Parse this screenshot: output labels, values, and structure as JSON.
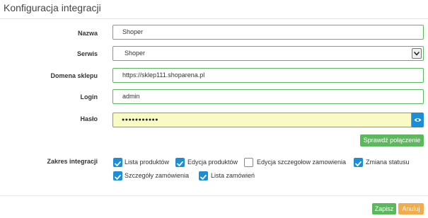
{
  "header": {
    "title": "Konfiguracja integracji"
  },
  "form": {
    "name": {
      "label": "Nazwa",
      "value": "Shoper"
    },
    "service": {
      "label": "Serwis",
      "value": "Shoper"
    },
    "domain": {
      "label": "Domena sklepu",
      "value": "https://sklep111.shoparena.pl"
    },
    "login": {
      "label": "Login",
      "value": "admin"
    },
    "password": {
      "label": "Hasło",
      "value": "●●●●●●●●●●●"
    },
    "check_connection_label": "Sprawdź połączenie"
  },
  "scope": {
    "label": "Zakres integracji",
    "options": [
      {
        "label": "Lista produktów",
        "checked": true
      },
      {
        "label": "Edycja produktów",
        "checked": true
      },
      {
        "label": "Edycja szczegołow zamowienia",
        "checked": false
      },
      {
        "label": "Zmiana statusu",
        "checked": true
      },
      {
        "label": "Szczegóły zamówienia",
        "checked": true
      },
      {
        "label": "Lista zamówień",
        "checked": true
      }
    ]
  },
  "footer": {
    "save_label": "Zapisz",
    "cancel_label": "Anuluj"
  },
  "colors": {
    "accent": "#5cb85c",
    "primary": "#1e8ed4",
    "warning": "#f0ad4e",
    "password_bg": "#fafac4"
  },
  "icons": {
    "select_arrow": "chevron-down-icon",
    "show_password": "eye-icon",
    "checkbox": "checkmark-icon"
  }
}
